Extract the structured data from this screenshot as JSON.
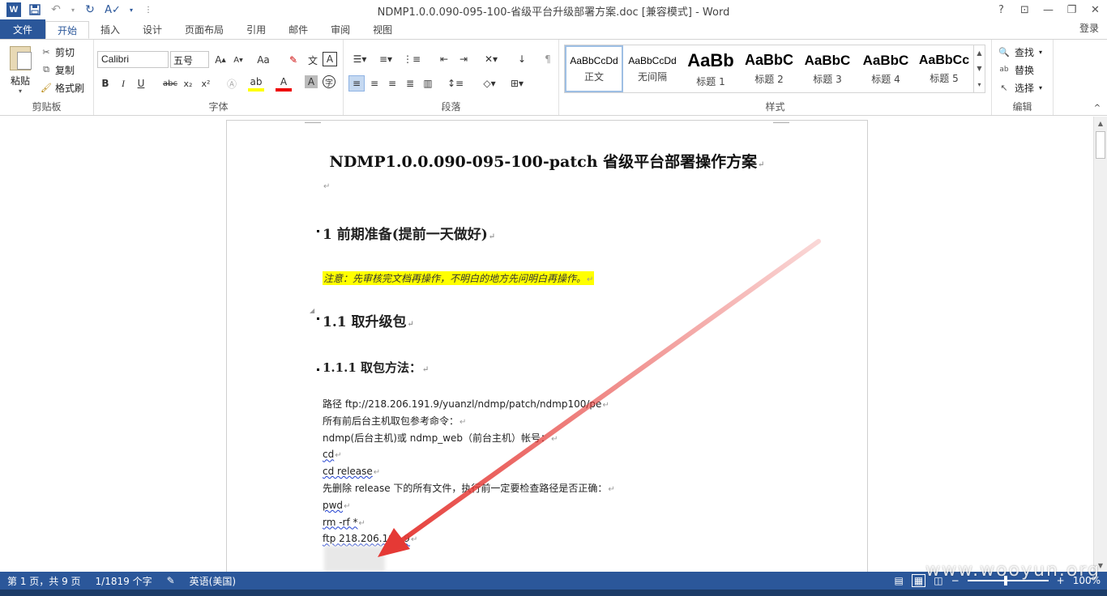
{
  "window": {
    "title": "NDMP1.0.0.090-095-100-省级平台升级部署方案.doc [兼容模式] - Word",
    "help": "?",
    "login": "登录"
  },
  "qat": {
    "word_logo": "W"
  },
  "tabs": [
    {
      "label": "文件"
    },
    {
      "label": "开始"
    },
    {
      "label": "插入"
    },
    {
      "label": "设计"
    },
    {
      "label": "页面布局"
    },
    {
      "label": "引用"
    },
    {
      "label": "邮件"
    },
    {
      "label": "审阅"
    },
    {
      "label": "视图"
    }
  ],
  "clipboard": {
    "paste": "粘贴",
    "cut": "剪切",
    "copy": "复制",
    "format_painter": "格式刷",
    "group_label": "剪贴板"
  },
  "font": {
    "name": "Calibri",
    "size": "五号",
    "case": "Aa",
    "group_label": "字体"
  },
  "paragraph": {
    "group_label": "段落"
  },
  "styles": {
    "items": [
      {
        "sample": "AaBbCcDd",
        "name": "正文",
        "size": 12,
        "bold": false
      },
      {
        "sample": "AaBbCcDd",
        "name": "无间隔",
        "size": 12,
        "bold": false
      },
      {
        "sample": "AaBb",
        "name": "标题 1",
        "size": 22,
        "bold": true
      },
      {
        "sample": "AaBbC",
        "name": "标题 2",
        "size": 18,
        "bold": true
      },
      {
        "sample": "AaBbC",
        "name": "标题 3",
        "size": 17,
        "bold": true
      },
      {
        "sample": "AaBbC",
        "name": "标题 4",
        "size": 17,
        "bold": true
      },
      {
        "sample": "AaBbCc",
        "name": "标题 5",
        "size": 16,
        "bold": true
      }
    ],
    "group_label": "样式"
  },
  "editing": {
    "find": "查找",
    "replace": "替换",
    "select": "选择",
    "group_label": "编辑"
  },
  "document": {
    "title": "NDMP1.0.0.090-095-100-patch 省级平台部署操作方案",
    "h1": "1  前期准备(提前一天做好)",
    "note": "注意：先审核完文档再操作，不明白的地方先问明白再操作。",
    "h2": "1.1 取升级包",
    "h3": "1.1.1 取包方法：",
    "lines": [
      "路径 ftp://218.206.191.9/yuanzl/ndmp/patch/ndmp100/pe",
      "所有前后台主机取包参考命令：",
      "ndmp(后台主机)或 ndmp_web（前台主机）帐号：",
      "cd",
      "cd release",
      "先删除 release 下的所有文件，执行前一定要检查路径是否正确：",
      "pwd",
      "rm -rf *",
      "ftp 218.206.191.9"
    ]
  },
  "statusbar": {
    "page": "第 1 页，共 9 页",
    "words": "1/1819 个字",
    "language": "英语(美国)",
    "zoom": "100%"
  },
  "watermark": "www.wooyun.org",
  "colors": {
    "accent": "#2b579a",
    "highlight": "#ffff00",
    "arrow": "#e53935"
  }
}
